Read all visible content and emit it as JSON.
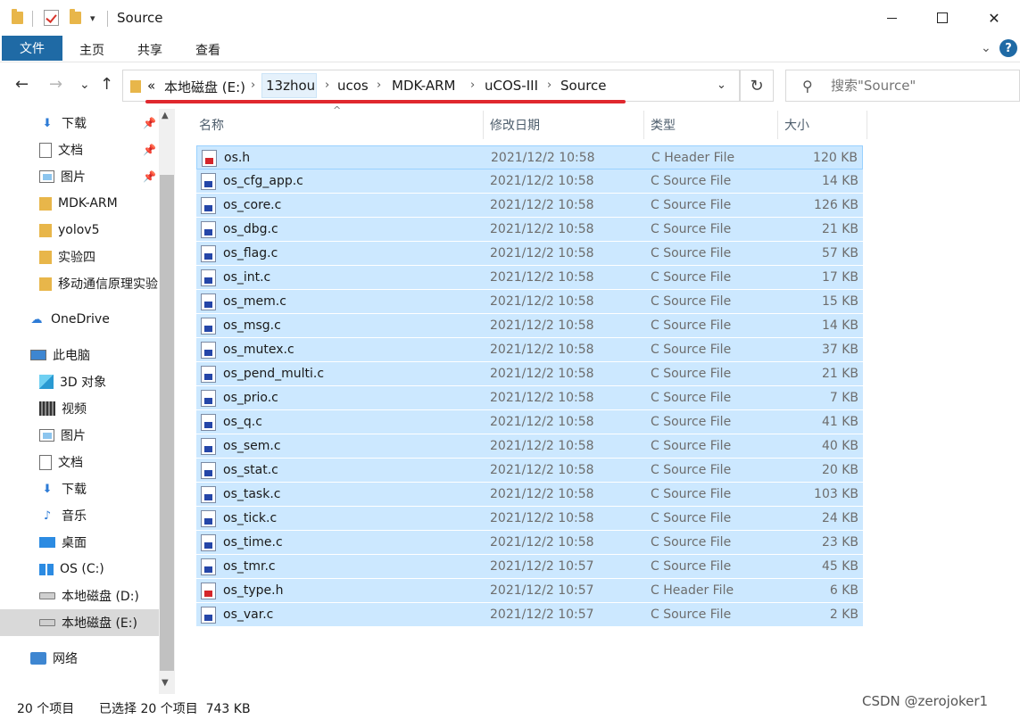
{
  "window": {
    "title": "Source",
    "quick_access_dropdown": "▾",
    "minimize": "",
    "maximize": "",
    "close": "✕"
  },
  "ribbon": {
    "tabs": [
      "文件",
      "主页",
      "共享",
      "查看"
    ],
    "expand": "⌄",
    "help": "?"
  },
  "nav": {
    "back": "←",
    "forward": "→",
    "recent": "⌄",
    "up": "↑"
  },
  "address": {
    "overflow": "«",
    "crumbs": [
      "本地磁盘 (E:)",
      "13zhou",
      "ucos",
      "MDK-ARM",
      "uCOS-III",
      "Source"
    ],
    "separator": "›",
    "dropdown": "⌄",
    "refresh": "↻"
  },
  "search": {
    "placeholder": "搜索\"Source\"",
    "icon": "⚲"
  },
  "columns": {
    "name": "名称",
    "date": "修改日期",
    "type": "类型",
    "size": "大小",
    "sort": "^"
  },
  "sidebar": {
    "items": [
      {
        "label": "下载",
        "icon": "download-icon",
        "pinned": true
      },
      {
        "label": "文档",
        "icon": "document-icon",
        "pinned": true
      },
      {
        "label": "图片",
        "icon": "picture-icon",
        "pinned": true
      },
      {
        "label": "MDK-ARM",
        "icon": "folder-icon"
      },
      {
        "label": "yolov5",
        "icon": "folder-icon"
      },
      {
        "label": "实验四",
        "icon": "folder-icon"
      },
      {
        "label": "移动通信原理实验",
        "icon": "folder-icon"
      },
      {
        "label": "OneDrive",
        "icon": "onedrive-icon"
      },
      {
        "label": "此电脑",
        "icon": "computer-icon"
      },
      {
        "label": "3D 对象",
        "icon": "3d-objects-icon"
      },
      {
        "label": "视频",
        "icon": "video-icon"
      },
      {
        "label": "图片",
        "icon": "picture-icon"
      },
      {
        "label": "文档",
        "icon": "document-icon"
      },
      {
        "label": "下载",
        "icon": "download-icon"
      },
      {
        "label": "音乐",
        "icon": "music-icon"
      },
      {
        "label": "桌面",
        "icon": "desktop-icon"
      },
      {
        "label": "OS (C:)",
        "icon": "os-drive-icon"
      },
      {
        "label": "本地磁盘 (D:)",
        "icon": "drive-icon"
      },
      {
        "label": "本地磁盘 (E:)",
        "icon": "drive-icon",
        "selected": true
      },
      {
        "label": "网络",
        "icon": "network-icon"
      }
    ],
    "pin": "📌",
    "scroll_up": "▲",
    "scroll_down": "▼"
  },
  "files": [
    {
      "name": "os.h",
      "date": "2021/12/2 10:58",
      "type": "C Header File",
      "size": "120 KB"
    },
    {
      "name": "os_cfg_app.c",
      "date": "2021/12/2 10:58",
      "type": "C Source File",
      "size": "14 KB"
    },
    {
      "name": "os_core.c",
      "date": "2021/12/2 10:58",
      "type": "C Source File",
      "size": "126 KB"
    },
    {
      "name": "os_dbg.c",
      "date": "2021/12/2 10:58",
      "type": "C Source File",
      "size": "21 KB"
    },
    {
      "name": "os_flag.c",
      "date": "2021/12/2 10:58",
      "type": "C Source File",
      "size": "57 KB"
    },
    {
      "name": "os_int.c",
      "date": "2021/12/2 10:58",
      "type": "C Source File",
      "size": "17 KB"
    },
    {
      "name": "os_mem.c",
      "date": "2021/12/2 10:58",
      "type": "C Source File",
      "size": "15 KB"
    },
    {
      "name": "os_msg.c",
      "date": "2021/12/2 10:58",
      "type": "C Source File",
      "size": "14 KB"
    },
    {
      "name": "os_mutex.c",
      "date": "2021/12/2 10:58",
      "type": "C Source File",
      "size": "37 KB"
    },
    {
      "name": "os_pend_multi.c",
      "date": "2021/12/2 10:58",
      "type": "C Source File",
      "size": "21 KB"
    },
    {
      "name": "os_prio.c",
      "date": "2021/12/2 10:58",
      "type": "C Source File",
      "size": "7 KB"
    },
    {
      "name": "os_q.c",
      "date": "2021/12/2 10:58",
      "type": "C Source File",
      "size": "41 KB"
    },
    {
      "name": "os_sem.c",
      "date": "2021/12/2 10:58",
      "type": "C Source File",
      "size": "40 KB"
    },
    {
      "name": "os_stat.c",
      "date": "2021/12/2 10:58",
      "type": "C Source File",
      "size": "20 KB"
    },
    {
      "name": "os_task.c",
      "date": "2021/12/2 10:58",
      "type": "C Source File",
      "size": "103 KB"
    },
    {
      "name": "os_tick.c",
      "date": "2021/12/2 10:58",
      "type": "C Source File",
      "size": "24 KB"
    },
    {
      "name": "os_time.c",
      "date": "2021/12/2 10:58",
      "type": "C Source File",
      "size": "23 KB"
    },
    {
      "name": "os_tmr.c",
      "date": "2021/12/2 10:57",
      "type": "C Source File",
      "size": "45 KB"
    },
    {
      "name": "os_type.h",
      "date": "2021/12/2 10:57",
      "type": "C Header File",
      "size": "6 KB"
    },
    {
      "name": "os_var.c",
      "date": "2021/12/2 10:57",
      "type": "C Source File",
      "size": "2 KB"
    }
  ],
  "status": {
    "count": "20 个项目",
    "selection": "已选择 20 个项目  743 KB"
  },
  "watermark": "CSDN @zerojoker1",
  "colors": {
    "accent": "#1f6aa5",
    "selection": "#cce8ff",
    "annotation": "#e0282e"
  }
}
